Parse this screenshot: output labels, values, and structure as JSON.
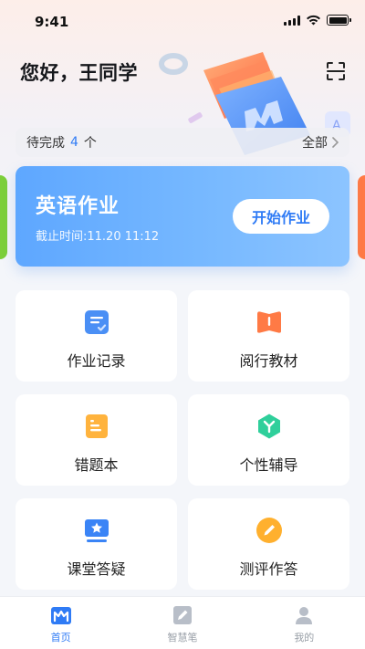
{
  "status_bar": {
    "time": "9:41"
  },
  "header": {
    "greeting": "您好，王同学"
  },
  "todo": {
    "label": "待完成",
    "count": "4",
    "unit": "个",
    "all_label": "全部"
  },
  "homework_card": {
    "title": "英语作业",
    "deadline": "截止时间:11.20 11:12",
    "start_label": "开始作业"
  },
  "grid": {
    "items": [
      {
        "label": "作业记录",
        "icon": "homework-record-icon",
        "color": "#4a8ff5"
      },
      {
        "label": "阅行教材",
        "icon": "textbook-icon",
        "color": "#ff7a45"
      },
      {
        "label": "错题本",
        "icon": "wrong-questions-icon",
        "color": "#ffb33d"
      },
      {
        "label": "个性辅导",
        "icon": "personal-tutor-icon",
        "color": "#2fcf9b"
      },
      {
        "label": "课堂答疑",
        "icon": "class-qa-icon",
        "color": "#3a84f6"
      },
      {
        "label": "测评作答",
        "icon": "assessment-icon",
        "color": "#ffb02e"
      }
    ]
  },
  "tabbar": {
    "items": [
      {
        "label": "首页",
        "active": true
      },
      {
        "label": "智慧笔",
        "active": false
      },
      {
        "label": "我的",
        "active": false
      }
    ]
  },
  "colors": {
    "accent": "#2f7bf5",
    "card_start": "#5ea7ff",
    "card_end": "#8cc4ff"
  }
}
